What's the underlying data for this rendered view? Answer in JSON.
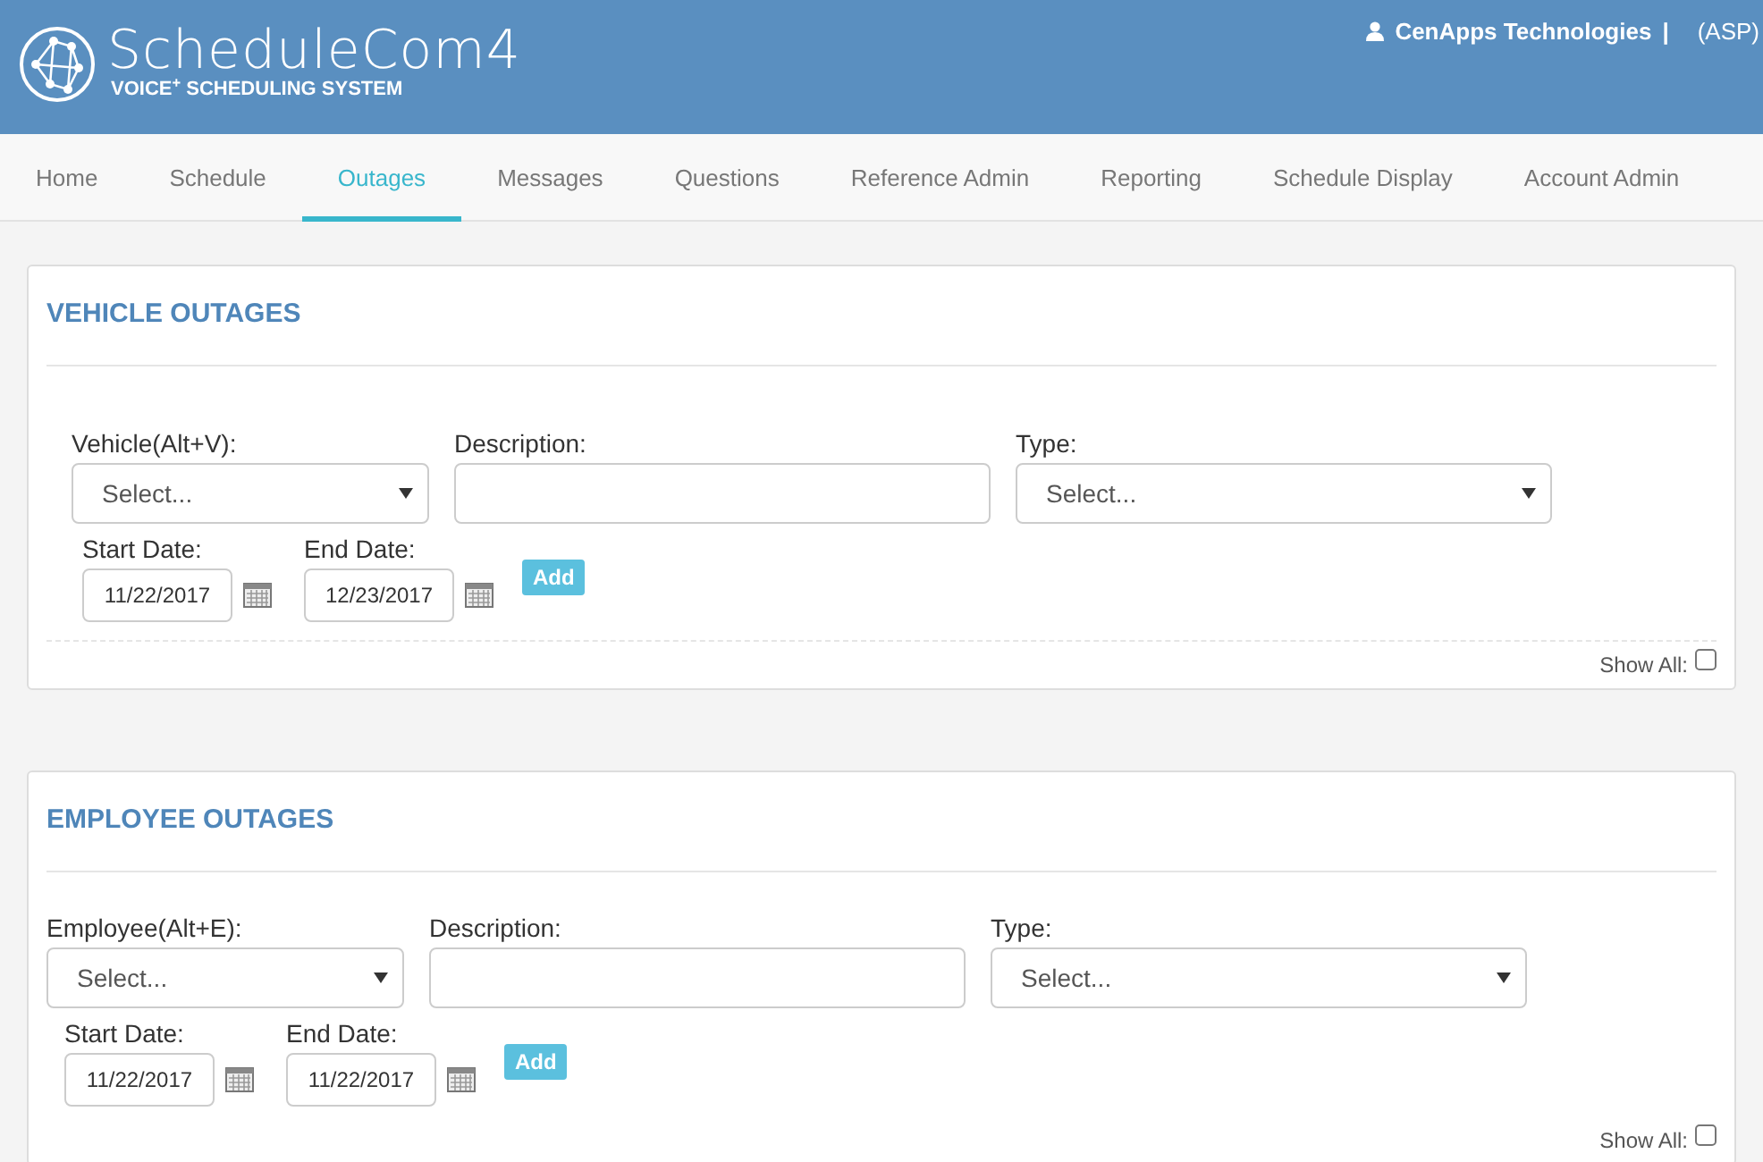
{
  "header": {
    "app_name": "ScheduleCom4",
    "tagline": "VOICE$^{+}$ SCHEDULING SYSTEM",
    "company": "CenApps Technologies",
    "separator": "|",
    "mode": "(ASP)"
  },
  "tabs": [
    {
      "label": "Home",
      "selected": false
    },
    {
      "label": "Schedule",
      "selected": false
    },
    {
      "label": "Outages",
      "selected": true
    },
    {
      "label": "Messages",
      "selected": false
    },
    {
      "label": "Questions",
      "selected": false
    },
    {
      "label": "Reference Admin",
      "selected": false
    },
    {
      "label": "Reporting",
      "selected": false
    },
    {
      "label": "Schedule Display",
      "selected": false
    },
    {
      "label": "Account Admin",
      "selected": false
    }
  ],
  "panels": [
    {
      "title": "VEHICLE OUTAGES",
      "subject_label": "Vehicle(Alt+V):",
      "subject_value": "Select...",
      "description_label": "Description:",
      "type_label": "Type:",
      "type_value": "Select...",
      "start_label": "Start Date:",
      "start_value": "11/22/2017",
      "end_label": "End Date:",
      "end_value": "12/23/2017",
      "add_button": "Add",
      "show_all_label": "Show All:",
      "show_all_checked": false
    },
    {
      "title": "EMPLOYEE OUTAGES",
      "subject_label": "Employee(Alt+E):",
      "subject_value": "Select...",
      "description_label": "Description:",
      "type_label": "Type:",
      "type_value": "Select...",
      "start_label": "Start Date:",
      "start_value": "11/22/2017",
      "end_label": "End Date:",
      "end_value": "11/22/2017",
      "add_button": "Add",
      "show_all_label": "Show All:",
      "show_all_checked": false
    }
  ]
}
